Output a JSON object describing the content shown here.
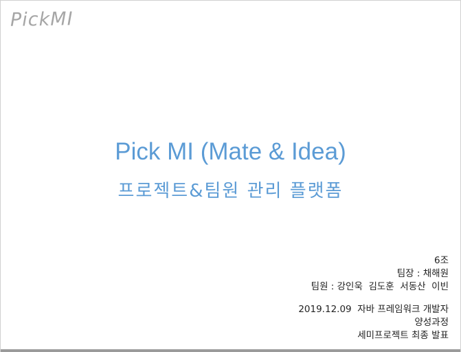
{
  "logo": {
    "text": "PickMI"
  },
  "title": {
    "main": "Pick MI (Mate & Idea)",
    "sub": "프로젝트&팀원 관리 플랫폼"
  },
  "team": {
    "group": "6조",
    "leader": "팀장 : 채해원",
    "members": "팀원 : 강인욱  김도훈  서동산  이빈"
  },
  "event": {
    "date_course": "2019.12.09  자바 프레임워크 개발자",
    "course_cont": "양성과정",
    "presentation": "세미프로젝트 최종 발표"
  }
}
